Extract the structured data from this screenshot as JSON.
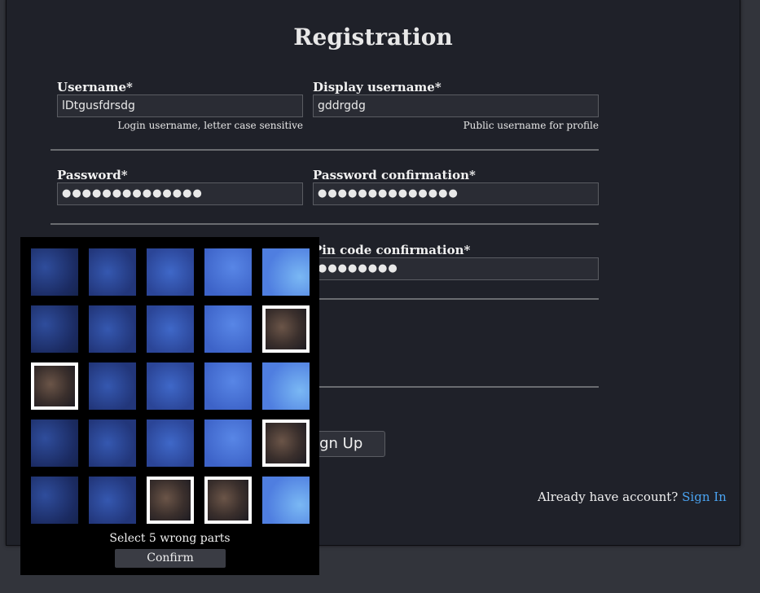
{
  "form": {
    "title": "Registration",
    "username": {
      "label": "Username*",
      "value": "lDtgusfdrsdg",
      "hint": "Login username, letter case sensitive"
    },
    "display_username": {
      "label": "Display username*",
      "value": "gddrgdg",
      "hint": "Public username for profile"
    },
    "password": {
      "label": "Password*",
      "value": "●●●●●●●●●●●●●●"
    },
    "password_confirmation": {
      "label": "Password confirmation*",
      "value": "●●●●●●●●●●●●●●"
    },
    "pin_confirmation": {
      "label": "Pin code confirmation*",
      "value": "●●●●●●●●"
    },
    "signup_label": "Sign Up",
    "already_text": "Already have account?",
    "signin_link": "Sign In"
  },
  "captcha": {
    "instruction": "Select 5 wrong parts",
    "confirm_label": "Confirm",
    "selected_tiles": [
      [
        1,
        4
      ],
      [
        2,
        0
      ],
      [
        3,
        4
      ],
      [
        4,
        2
      ],
      [
        4,
        3
      ]
    ]
  }
}
